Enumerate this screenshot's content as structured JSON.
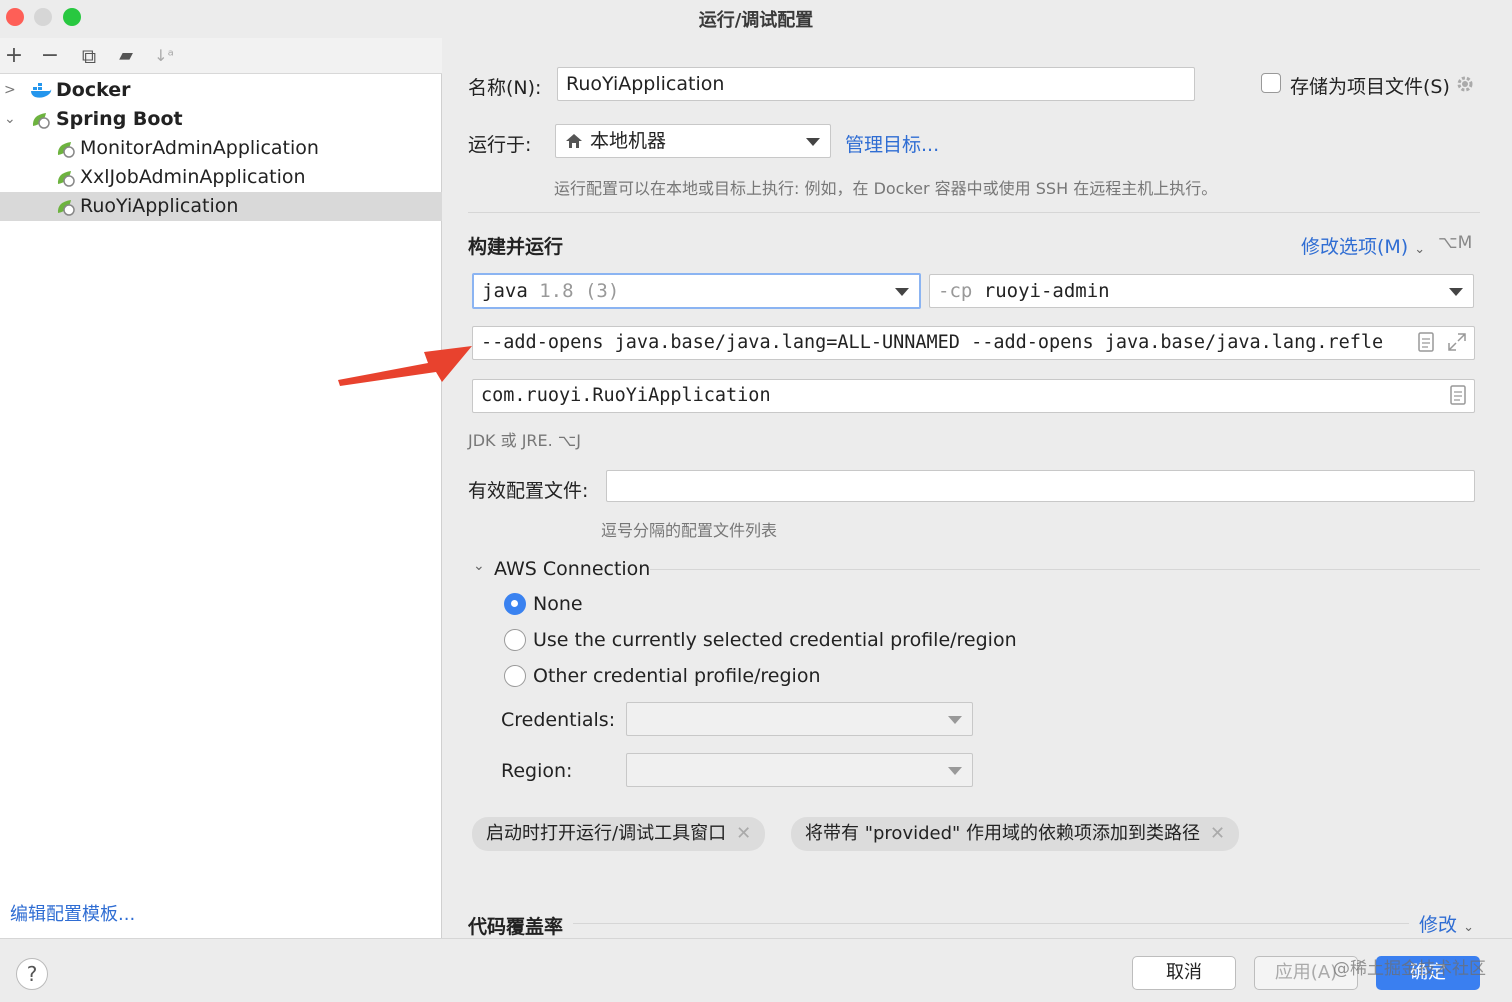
{
  "window": {
    "title": "运行/调试配置"
  },
  "toolbar": {
    "add": "+",
    "remove": "−",
    "copy": "⧉",
    "folder": "▰",
    "sort": "↓ᵃ"
  },
  "tree": {
    "items": [
      {
        "label": "Docker",
        "icon": "docker-icon",
        "expanded": false,
        "bold": true
      },
      {
        "label": "Spring Boot",
        "icon": "spring-boot-icon",
        "expanded": true,
        "bold": true
      },
      {
        "label": "MonitorAdminApplication",
        "icon": "spring-boot-run-icon"
      },
      {
        "label": "XxlJobAdminApplication",
        "icon": "spring-boot-run-icon"
      },
      {
        "label": "RuoYiApplication",
        "icon": "spring-boot-run-icon",
        "selected": true
      }
    ],
    "edit_templates": "编辑配置模板..."
  },
  "form": {
    "name_label": "名称(N):",
    "name_value": "RuoYiApplication",
    "store_label": "存储为项目文件(S)",
    "store_checked": false,
    "run_on_label": "运行于:",
    "run_on_value": "本地机器",
    "manage_targets": "管理目标...",
    "run_on_hint": "运行配置可以在本地或目标上执行: 例如，在 Docker 容器中或使用 SSH 在远程主机上执行。",
    "build_section": "构建并运行",
    "modify_options": "修改选项(M)",
    "modify_shortcut": "⌥M",
    "jdk_name": "java",
    "jdk_version": "1.8 (3)",
    "cp_prefix": "-cp",
    "cp_value": "ruoyi-admin",
    "vm_options": "--add-opens java.base/java.lang=ALL-UNNAMED --add-opens java.base/java.lang.refle",
    "main_class": "com.ruoyi.RuoYiApplication",
    "jdk_hint": "JDK 或 JRE. ⌥J",
    "profiles_label": "有效配置文件:",
    "profiles_value": "",
    "profiles_hint": "逗号分隔的配置文件列表"
  },
  "aws": {
    "title": "AWS Connection",
    "options": [
      {
        "label": "None",
        "selected": true
      },
      {
        "label": "Use the currently selected credential profile/region",
        "selected": false
      },
      {
        "label": "Other credential profile/region",
        "selected": false
      }
    ],
    "credentials_label": "Credentials:",
    "region_label": "Region:"
  },
  "chips": [
    "启动时打开运行/调试工具窗口",
    "将带有 \"provided\" 作用域的依赖项添加到类路径"
  ],
  "coverage": {
    "title": "代码覆盖率",
    "modify": "修改"
  },
  "buttons": {
    "help": "?",
    "cancel": "取消",
    "apply": "应用(A)",
    "ok": "确定"
  },
  "watermark": "@稀土掘金技术社区",
  "colors": {
    "accent": "#3a7ff0",
    "link": "#2f6dd3",
    "arrow": "#e8422e",
    "selection": "#d9d9d9"
  }
}
